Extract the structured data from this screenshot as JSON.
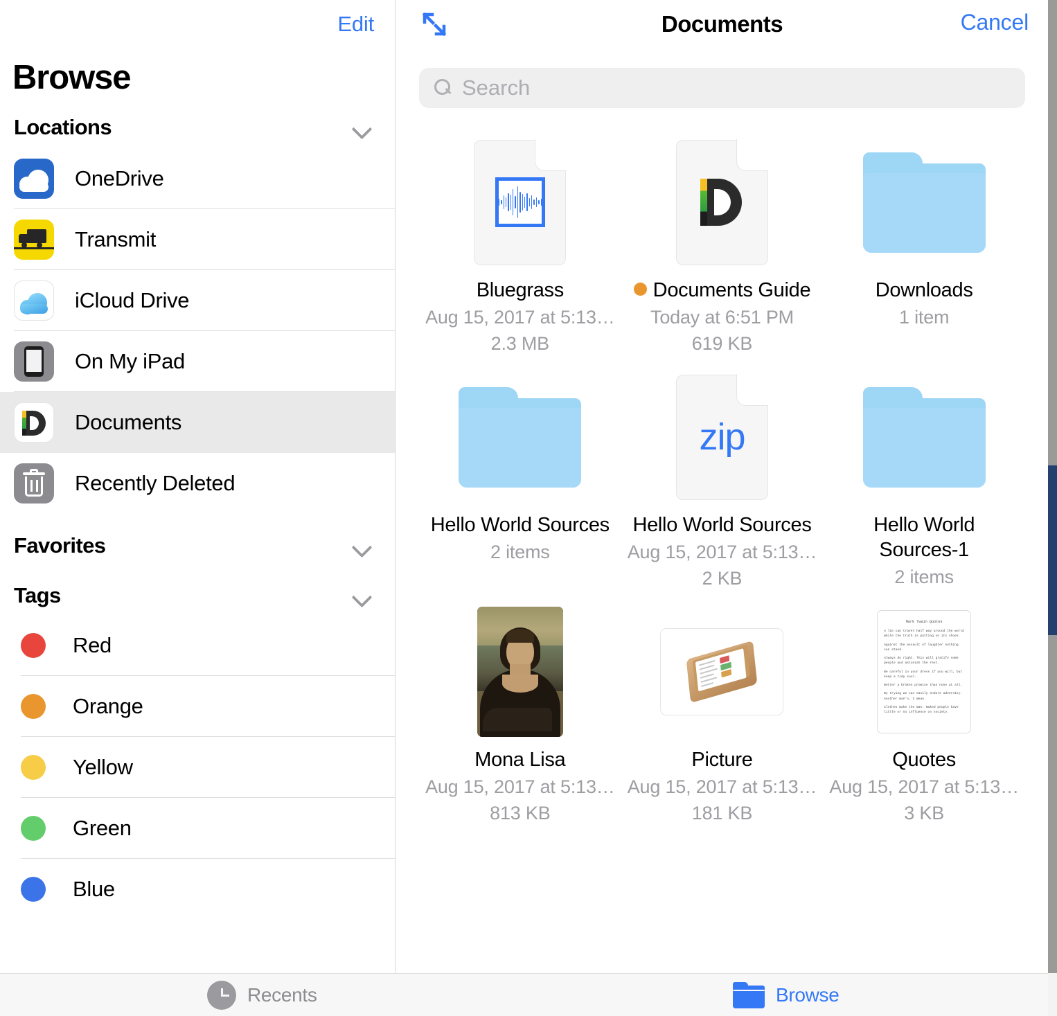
{
  "sidebar": {
    "edit_label": "Edit",
    "title": "Browse",
    "sections": {
      "locations": {
        "label": "Locations",
        "chevron": "chevron-down-icon"
      },
      "favorites": {
        "label": "Favorites",
        "chevron": "chevron-down-icon"
      },
      "tags": {
        "label": "Tags",
        "chevron": "chevron-down-icon"
      }
    },
    "locations": [
      {
        "label": "OneDrive",
        "icon": "onedrive-icon",
        "selected": false
      },
      {
        "label": "Transmit",
        "icon": "transmit-icon",
        "selected": false
      },
      {
        "label": "iCloud Drive",
        "icon": "icloud-drive-icon",
        "selected": false
      },
      {
        "label": "On My iPad",
        "icon": "ipad-icon",
        "selected": false
      },
      {
        "label": "Documents",
        "icon": "documents-app-icon",
        "selected": true
      },
      {
        "label": "Recently Deleted",
        "icon": "trash-icon",
        "selected": false
      }
    ],
    "tags": [
      {
        "label": "Red",
        "color": "#e8453c"
      },
      {
        "label": "Orange",
        "color": "#e8962d"
      },
      {
        "label": "Yellow",
        "color": "#f7cc46"
      },
      {
        "label": "Green",
        "color": "#63cc6b"
      },
      {
        "label": "Blue",
        "color": "#3b73e8"
      }
    ]
  },
  "content": {
    "expand_icon": "expand-arrows-icon",
    "title": "Documents",
    "cancel_label": "Cancel",
    "search": {
      "placeholder": "Search",
      "value": "",
      "icon": "search-icon"
    },
    "files": [
      {
        "name": "Bluegrass",
        "date": "Aug 15, 2017 at 5:13…",
        "size": "2.3 MB",
        "kind": "audio",
        "icon": "audio-waveform-document-icon",
        "tag_color": null
      },
      {
        "name": "Documents Guide",
        "date": "Today at 6:51 PM",
        "size": "619 KB",
        "kind": "document",
        "icon": "documents-guide-pdf-icon",
        "tag_color": "#e8962d"
      },
      {
        "name": "Downloads",
        "date": "",
        "size": "1 item",
        "kind": "folder",
        "icon": "folder-icon",
        "tag_color": null
      },
      {
        "name": "Hello World Sources",
        "date": "",
        "size": "2 items",
        "kind": "folder",
        "icon": "folder-icon",
        "tag_color": null
      },
      {
        "name": "Hello World Sources",
        "date": "Aug 15, 2017 at 5:13…",
        "size": "2 KB",
        "kind": "zip",
        "icon": "zip-document-icon",
        "tag_color": null
      },
      {
        "name": "Hello World Sources-1",
        "date": "",
        "size": "2 items",
        "kind": "folder",
        "icon": "folder-icon",
        "tag_color": null
      },
      {
        "name": "Mona Lisa",
        "date": "Aug 15, 2017 at 5:13…",
        "size": "813 KB",
        "kind": "image",
        "icon": "mona-lisa-thumbnail",
        "tag_color": null
      },
      {
        "name": "Picture",
        "date": "Aug 15, 2017 at 5:13…",
        "size": "181 KB",
        "kind": "image",
        "icon": "wooden-tray-thumbnail",
        "tag_color": null
      },
      {
        "name": "Quotes",
        "date": "Aug 15, 2017 at 5:13…",
        "size": "3 KB",
        "kind": "text",
        "icon": "text-document-thumbnail",
        "tag_color": null
      }
    ],
    "quotes_preview": {
      "title": "Mark Twain Quotes",
      "paragraphs": [
        "A lie can travel half way around the world while the truth is putting on its shoes.",
        "Against the assault of laughter nothing can stand.",
        "Always do right. This will gratify some people and astonish the rest.",
        "Be careful in your dress if you will, but keep a tidy soul.",
        "Better a broken promise than none at all.",
        "By trying we can easily endure adversity. Another man's, I mean.",
        "Clothes make the man. Naked people have little or no influence on society."
      ]
    }
  },
  "tabbar": [
    {
      "label": "Recents",
      "icon": "clock-icon",
      "active": false
    },
    {
      "label": "Browse",
      "icon": "folder-icon",
      "active": true
    }
  ],
  "colors": {
    "accent": "#3478f6",
    "folder": "#9ed6f5",
    "selected_row": "#e9e9e9",
    "meta_text": "#9d9da2"
  }
}
